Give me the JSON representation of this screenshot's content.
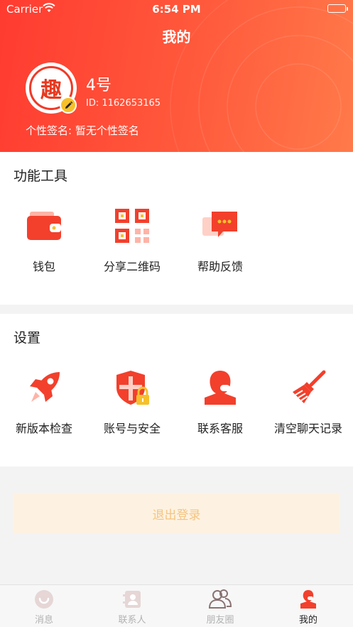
{
  "status_bar": {
    "carrier": "Carrier",
    "time": "6:54 PM"
  },
  "header": {
    "title": "我的",
    "avatar_char": "趣",
    "username": "4号",
    "user_id": "ID:  1162653165",
    "signature": "个性签名:  暂无个性签名"
  },
  "tools": {
    "title": "功能工具",
    "items": [
      {
        "label": "钱包",
        "icon": "wallet-icon"
      },
      {
        "label": "分享二维码",
        "icon": "qr-code-icon"
      },
      {
        "label": "帮助反馈",
        "icon": "feedback-chat-icon"
      }
    ]
  },
  "settings": {
    "title": "设置",
    "items": [
      {
        "label": "新版本检查",
        "icon": "rocket-icon"
      },
      {
        "label": "账号与安全",
        "icon": "shield-lock-icon"
      },
      {
        "label": "联系客服",
        "icon": "customer-service-icon"
      },
      {
        "label": "清空聊天记录",
        "icon": "broom-icon"
      }
    ]
  },
  "logout": {
    "label": "退出登录"
  },
  "tabbar": {
    "items": [
      {
        "label": "消息",
        "icon": "message-icon"
      },
      {
        "label": "联系人",
        "icon": "contacts-icon"
      },
      {
        "label": "朋友圈",
        "icon": "moments-icon"
      },
      {
        "label": "我的",
        "icon": "profile-icon"
      }
    ],
    "active": "我的"
  },
  "colors": {
    "brand_red": "#ff3b30",
    "accent_yellow": "#f6c02c",
    "logout_bg": "#fdf2e1",
    "logout_text": "#f5c480"
  }
}
